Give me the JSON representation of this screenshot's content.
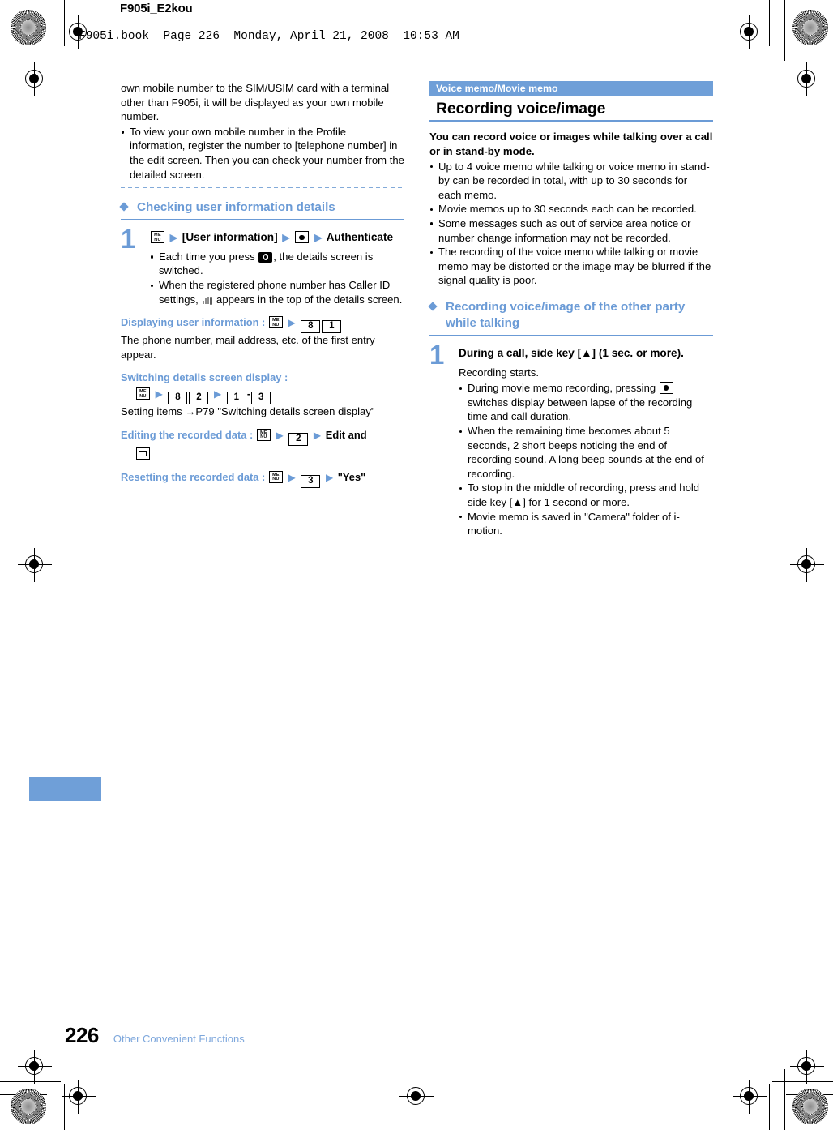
{
  "header": {
    "title": "F905i_E2kou",
    "slug": "F905i.book  Page 226  Monday, April 21, 2008  10:53 AM"
  },
  "colors": {
    "accent_blue": "#6b9bd6",
    "bar_blue": "#6f9fd8",
    "link_blue": "#7da7dc",
    "text_black": "#000000"
  },
  "left_column": {
    "continued_paragraph": "own mobile number to the SIM/USIM card with a terminal other than F905i, it will be displayed as your own mobile number.",
    "continued_bullets": [
      "To view your own mobile number in the Profile information, register the number to [telephone number] in the edit screen. Then you can check your number from the detailed screen."
    ],
    "subheading": "Checking user information details",
    "step": {
      "number": "1",
      "title_parts": {
        "menu_key": "MENU",
        "arrow": "▶",
        "bracket_item": "[User information]",
        "center_key": "center-select",
        "final": "Authenticate"
      },
      "bullets": [
        {
          "before": "Each time you press ",
          "icon": "camera-key",
          "after": ", the details screen is switched."
        },
        {
          "before": "When the registered phone number has Caller ID settings, ",
          "icon": "caller-id-icon",
          "after": " appears in the top of the details screen."
        }
      ]
    },
    "procedures": [
      {
        "label": "Displaying user information :",
        "keys": [
          "MENU",
          "8",
          "1"
        ],
        "body": "The phone number, mail address, etc. of the first entry appear."
      },
      {
        "label": "Switching details screen display :",
        "keys": [
          "MENU",
          "8",
          "2",
          "1",
          "3"
        ],
        "body": "Setting items →P79 \"Switching details screen display\""
      },
      {
        "label": "Editing the recorded data :",
        "keys": [
          "MENU",
          "2"
        ],
        "trailing_bold": "Edit and",
        "trailing_icon": "book-key"
      },
      {
        "label": "Resetting the recorded data :",
        "keys": [
          "MENU",
          "3"
        ],
        "trailing_bold": "\"Yes\""
      }
    ]
  },
  "right_column": {
    "section_bar": "Voice memo/Movie memo",
    "section_title": "Recording voice/image",
    "lead": "You can record voice or images while talking over a call or in stand-by mode.",
    "lead_bullets": [
      "Up to 4 voice memo while talking or voice memo in stand-by can be recorded in total, with up to 30 seconds for each memo.",
      "Movie memos up to 30 seconds each can be recorded.",
      "Some messages such as out of service area notice or number change information may not be recorded.",
      "The recording of the voice memo while talking or movie memo may be distorted or the image may be blurred if the signal quality is poor."
    ],
    "subheading": "Recording voice/image of the other party while talking",
    "step": {
      "number": "1",
      "title": "During a call, side key [▲] (1 sec. or more).",
      "body": "Recording starts.",
      "bullets": [
        {
          "before": "During movie memo recording, pressing ",
          "icon": "center-select-key",
          "after": " switches display between lapse of the recording time and call duration."
        },
        {
          "text": "When the remaining time becomes about 5 seconds, 2 short beeps noticing the end of recording sound. A long beep sounds at the end of recording."
        },
        {
          "text": "To stop in the middle of recording, press and hold side key [▲] for 1 second or more."
        },
        {
          "text": "Movie memo is saved in \"Camera\" folder of i-motion."
        }
      ]
    }
  },
  "footer": {
    "page_number": "226",
    "chapter": "Other Convenient Functions"
  }
}
